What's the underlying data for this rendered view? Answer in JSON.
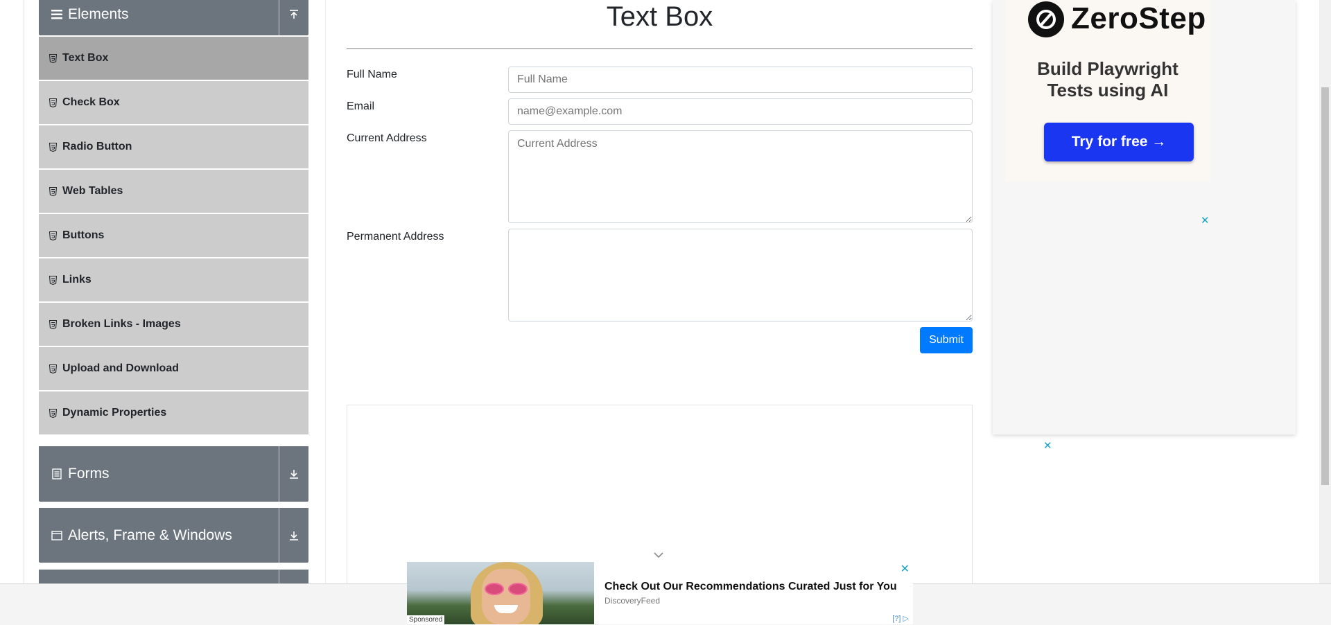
{
  "sidebar": {
    "elements_header": "Elements",
    "items": [
      {
        "label": "Text Box",
        "active": true
      },
      {
        "label": "Check Box"
      },
      {
        "label": "Radio Button"
      },
      {
        "label": "Web Tables"
      },
      {
        "label": "Buttons"
      },
      {
        "label": "Links"
      },
      {
        "label": "Broken Links - Images"
      },
      {
        "label": "Upload and Download"
      },
      {
        "label": "Dynamic Properties"
      }
    ],
    "forms_header": "Forms",
    "alerts_header": "Alerts, Frame & Windows"
  },
  "main": {
    "title": "Text Box",
    "full_name_label": "Full Name",
    "full_name_placeholder": "Full Name",
    "email_label": "Email",
    "email_placeholder": "name@example.com",
    "current_address_label": "Current Address",
    "current_address_placeholder": "Current Address",
    "permanent_address_label": "Permanent Address",
    "submit_label": "Submit"
  },
  "ad_right": {
    "brand": "ZeroStep",
    "tagline_line1": "Build Playwright",
    "tagline_line2": "Tests using AI",
    "cta": "Try for free →",
    "close": "✕"
  },
  "bottom_ad": {
    "title": "Check Out Our Recommendations Curated Just for You",
    "source": "DiscoveryFeed",
    "sponsored": "Sponsored",
    "adchoices": "[?]",
    "close": "✕"
  },
  "colors": {
    "accent": "#007bff",
    "sidebar_header": "#6c757d",
    "sidebar_item": "#cccccc",
    "sidebar_item_active": "#a7a7a7",
    "cta": "#1a36f0"
  }
}
